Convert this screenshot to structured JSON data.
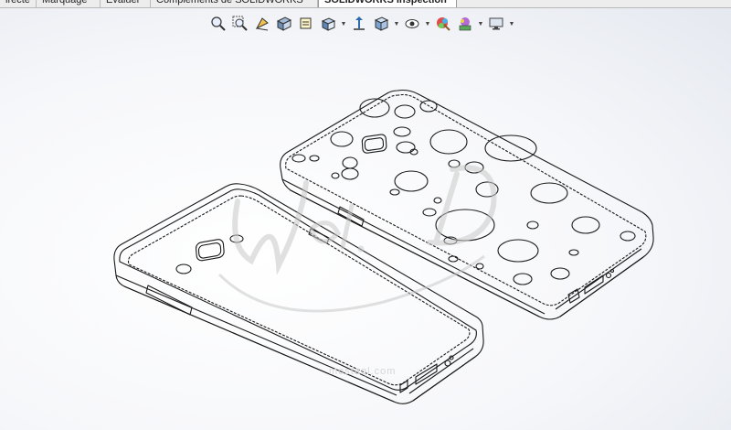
{
  "tabs": [
    {
      "label": "irecte"
    },
    {
      "label": "Marquage"
    },
    {
      "label": "Evaluer"
    },
    {
      "label": "Compléments de SOLIDWORKS"
    },
    {
      "label": "SOLIDWORKS Inspection",
      "active": true
    }
  ],
  "toolbar": {
    "icons": [
      "zoom-to-fit-icon",
      "zoom-to-area-icon",
      "previous-view-icon",
      "section-view-icon",
      "dynamic-annotation-icon",
      "view-orientation-icon",
      "normal-to-icon",
      "display-style-icon",
      "hide-show-items-icon",
      "edit-appearance-icon",
      "apply-scene-icon",
      "view-settings-icon"
    ]
  },
  "watermark": {
    "logo": "Wael.D",
    "site": "mostaql.com"
  },
  "colors": {
    "line": "#1a1a1a",
    "watermark": "#c9c9c9"
  }
}
